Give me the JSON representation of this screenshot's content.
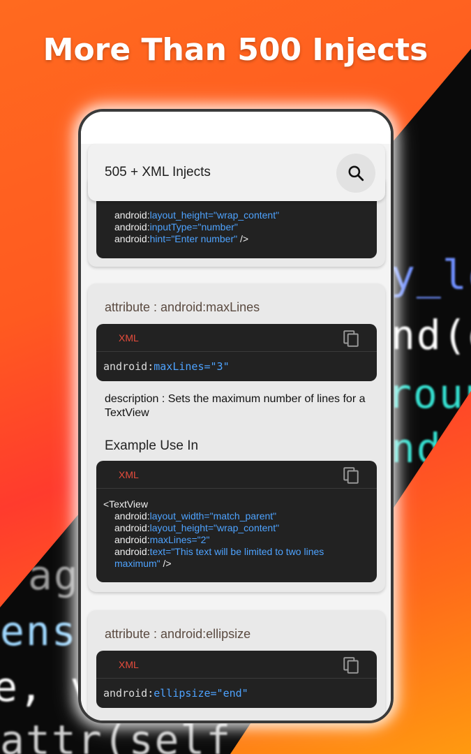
{
  "hero": {
    "title": "More Than 500 Injects"
  },
  "background_code": [
    {
      "text": "y_lo",
      "color": "#6f8fff"
    },
    {
      "text": "nd(g",
      "color": "#ffffff"
    },
    {
      "text": "roun",
      "color": "#35e0d0"
    },
    {
      "text": "nd(",
      "color": "#35e0d0"
    },
    {
      "text": "ag",
      "color": "#9a9a9a"
    },
    {
      "text": "ens",
      "color": "#9fd8ff"
    },
    {
      "text": "e, v",
      "color": "#ffffff"
    },
    {
      "text": "attr(self,",
      "color": "#cfcfcf"
    }
  ],
  "app": {
    "title": "505 + XML Injects",
    "search_icon": "search-icon"
  },
  "cards": {
    "partial_top": {
      "lines": [
        {
          "key": "android:",
          "attr": "layout_height=\"wrap_content\"",
          "tail": ""
        },
        {
          "key": "android:",
          "attr": "inputType=\"number\"",
          "tail": ""
        },
        {
          "key": "android:",
          "attr": "hint=\"Enter number\"",
          "tail": " />"
        }
      ]
    },
    "maxlines": {
      "title": "attribute : android:maxLines",
      "lang": "XML",
      "code_key": "android:",
      "code_value": "maxLines=\"3\"",
      "description": "description : Sets the maximum number of lines for a TextView",
      "example_title": "Example Use In",
      "example_lang": "XML",
      "example_open": "<TextView",
      "example_lines": [
        {
          "key": "android:",
          "attr": "layout_width=\"match_parent\"",
          "tail": ""
        },
        {
          "key": "android:",
          "attr": "layout_height=\"wrap_content\"",
          "tail": ""
        },
        {
          "key": "android:",
          "attr": "maxLines=\"2\"",
          "tail": ""
        },
        {
          "key": "android:",
          "attr": "text=\"This text will be limited to two lines maximum\"",
          "tail": " />"
        }
      ]
    },
    "ellipsize": {
      "title": "attribute : android:ellipsize",
      "lang": "XML",
      "code_key": "android:",
      "code_value": "ellipsize=\"end\""
    }
  },
  "colors": {
    "accent_value": "#4ea3ff",
    "lang_label": "#e74c3c",
    "code_bg": "#222222"
  }
}
